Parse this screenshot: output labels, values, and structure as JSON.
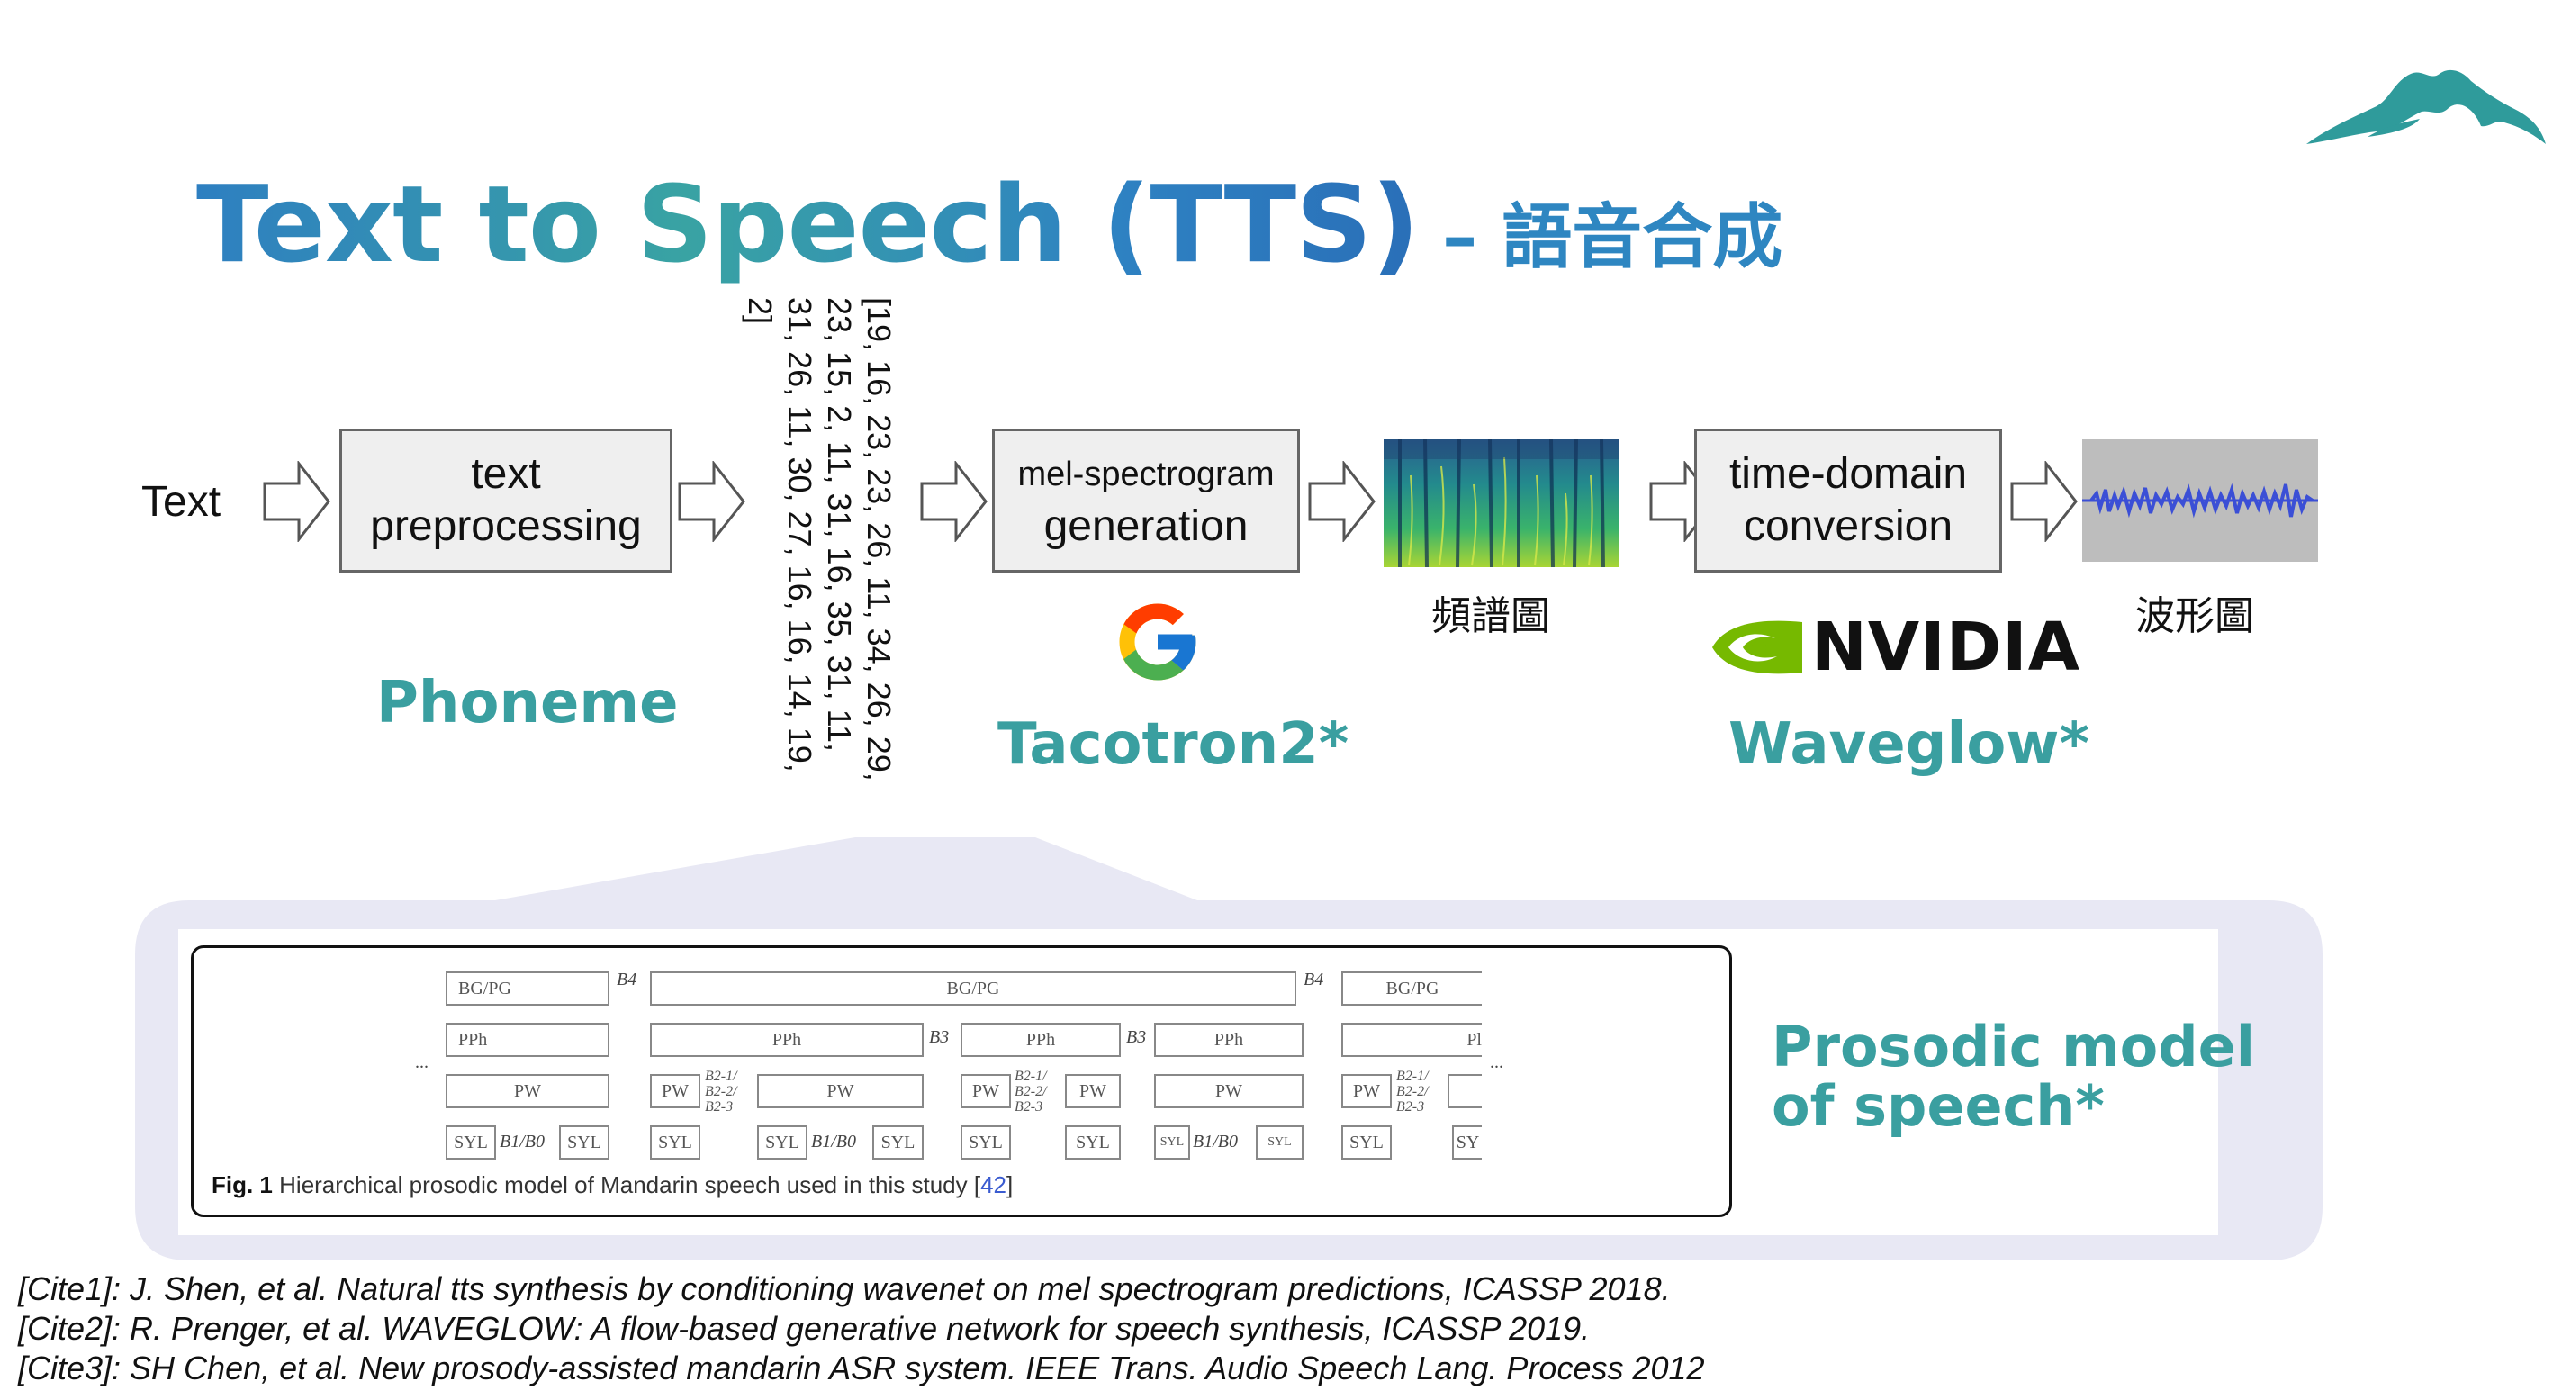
{
  "title": {
    "main": "Text to Speech (TTS)",
    "sub": "– 語音合成"
  },
  "pipeline": {
    "input_label": "Text",
    "box1": {
      "line1": "text",
      "line2": "preprocessing"
    },
    "box1_caption": "Phoneme",
    "phoneme_sequence": "[19, 16, 23, 23, 26, 11, 34, 26, 29, 23, 15, 2, 11, 31, 16, 35, 31, 11, 31, 26, 11, 30, 27, 16, 16, 14, 19, 2]",
    "box2": {
      "line1": "mel-spectrogram",
      "line2": "generation"
    },
    "box2_caption": "Tacotron2*",
    "spectrogram_label": "頻譜圖",
    "box3": {
      "line1": "time-domain",
      "line2": "conversion"
    },
    "box3_caption": "Waveglow*",
    "nvidia_wordmark": "NVIDIA",
    "waveform_label": "波形圖"
  },
  "prosody": {
    "caption_line1": "Prosodic model",
    "caption_line2": "of speech*",
    "figure_caption_bold": "Fig. 1",
    "figure_caption_text": "Hierarchical prosodic model of Mandarin speech used in this study [",
    "figure_caption_ref": "42",
    "figure_caption_end": "]",
    "labels": {
      "bgpg": "BG/PG",
      "pph": "PPh",
      "pw": "PW",
      "syl": "SYL",
      "b4": "B4",
      "b3": "B3",
      "b1b0": "B1/B0",
      "b2": "B2-1/\nB2-2/\nB2-3",
      "ellipsis": "...",
      "pph_cut": "Pl",
      "syl_cut": "SY"
    }
  },
  "citations": [
    "[Cite1]: J. Shen, et al. Natural tts synthesis by conditioning wavenet on mel spectrogram predictions, ICASSP 2018.",
    "[Cite2]: R. Prenger, et al. WAVEGLOW: A flow-based generative network for speech synthesis, ICASSP 2019.",
    "[Cite3]: SH Chen, et al. New prosody-assisted mandarin ASR system. IEEE Trans. Audio Speech Lang. Process 2012"
  ],
  "colors": {
    "teal": "#3a9fa0",
    "title_blue": "#2e7fc1",
    "callout": "#e8e8f4",
    "nvidia_green": "#76b900"
  },
  "icons": [
    "mountain-logo-icon",
    "google-logo-icon",
    "nvidia-logo-icon"
  ]
}
